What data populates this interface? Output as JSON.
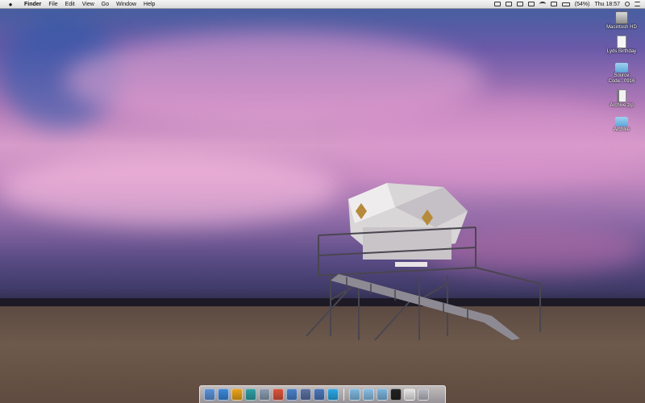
{
  "menubar": {
    "app_name": "Finder",
    "menus": [
      "File",
      "Edit",
      "View",
      "Go",
      "Window",
      "Help"
    ],
    "battery_text": "(54%)",
    "clock": "Thu 18:57"
  },
  "desktop_icons": [
    {
      "label": "Macintosh HD",
      "type": "drive"
    },
    {
      "label": "Lyds Birthday",
      "type": "document"
    },
    {
      "label": "Source Code...0916",
      "type": "folder"
    },
    {
      "label": "Archive.zip",
      "type": "zip"
    },
    {
      "label": "Archive",
      "type": "folder"
    }
  ],
  "dock": {
    "apps": [
      {
        "name": "finder-icon",
        "color": "#5b8fd6"
      },
      {
        "name": "safari-icon",
        "color": "#3c86d8"
      },
      {
        "name": "opera-icon",
        "color": "#e8a21a"
      },
      {
        "name": "cyberduck-icon",
        "color": "#2f9ea3"
      },
      {
        "name": "preview-icon",
        "color": "#8a9bb0"
      },
      {
        "name": "chrome-icon",
        "color": "#d9533d"
      },
      {
        "name": "itunes-icon",
        "color": "#4a7fc8"
      },
      {
        "name": "textmate-icon",
        "color": "#5a6fa0"
      },
      {
        "name": "xcode-icon",
        "color": "#4b74b8"
      },
      {
        "name": "skype-icon",
        "color": "#2ba6e3"
      }
    ],
    "stacks": [
      {
        "name": "applications-folder-icon",
        "color": "#7fb8e0"
      },
      {
        "name": "documents-folder-icon",
        "color": "#86bde3"
      },
      {
        "name": "downloads-folder-icon",
        "color": "#7ab3dc"
      },
      {
        "name": "terminal-icon",
        "color": "#222222"
      },
      {
        "name": "window-icon",
        "color": "#e6e6e6"
      },
      {
        "name": "trash-icon",
        "color": "#b8b8c0"
      }
    ]
  }
}
